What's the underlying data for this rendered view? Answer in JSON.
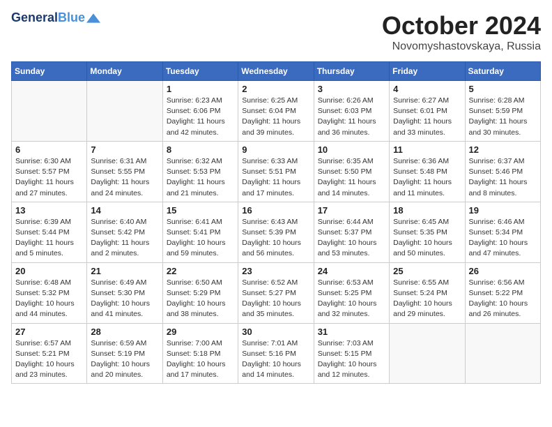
{
  "header": {
    "logo_line1": "General",
    "logo_line2": "Blue",
    "month_year": "October 2024",
    "location": "Novomyshastovskaya, Russia"
  },
  "weekdays": [
    "Sunday",
    "Monday",
    "Tuesday",
    "Wednesday",
    "Thursday",
    "Friday",
    "Saturday"
  ],
  "weeks": [
    [
      {
        "day": "",
        "info": ""
      },
      {
        "day": "",
        "info": ""
      },
      {
        "day": "1",
        "info": "Sunrise: 6:23 AM\nSunset: 6:06 PM\nDaylight: 11 hours and 42 minutes."
      },
      {
        "day": "2",
        "info": "Sunrise: 6:25 AM\nSunset: 6:04 PM\nDaylight: 11 hours and 39 minutes."
      },
      {
        "day": "3",
        "info": "Sunrise: 6:26 AM\nSunset: 6:03 PM\nDaylight: 11 hours and 36 minutes."
      },
      {
        "day": "4",
        "info": "Sunrise: 6:27 AM\nSunset: 6:01 PM\nDaylight: 11 hours and 33 minutes."
      },
      {
        "day": "5",
        "info": "Sunrise: 6:28 AM\nSunset: 5:59 PM\nDaylight: 11 hours and 30 minutes."
      }
    ],
    [
      {
        "day": "6",
        "info": "Sunrise: 6:30 AM\nSunset: 5:57 PM\nDaylight: 11 hours and 27 minutes."
      },
      {
        "day": "7",
        "info": "Sunrise: 6:31 AM\nSunset: 5:55 PM\nDaylight: 11 hours and 24 minutes."
      },
      {
        "day": "8",
        "info": "Sunrise: 6:32 AM\nSunset: 5:53 PM\nDaylight: 11 hours and 21 minutes."
      },
      {
        "day": "9",
        "info": "Sunrise: 6:33 AM\nSunset: 5:51 PM\nDaylight: 11 hours and 17 minutes."
      },
      {
        "day": "10",
        "info": "Sunrise: 6:35 AM\nSunset: 5:50 PM\nDaylight: 11 hours and 14 minutes."
      },
      {
        "day": "11",
        "info": "Sunrise: 6:36 AM\nSunset: 5:48 PM\nDaylight: 11 hours and 11 minutes."
      },
      {
        "day": "12",
        "info": "Sunrise: 6:37 AM\nSunset: 5:46 PM\nDaylight: 11 hours and 8 minutes."
      }
    ],
    [
      {
        "day": "13",
        "info": "Sunrise: 6:39 AM\nSunset: 5:44 PM\nDaylight: 11 hours and 5 minutes."
      },
      {
        "day": "14",
        "info": "Sunrise: 6:40 AM\nSunset: 5:42 PM\nDaylight: 11 hours and 2 minutes."
      },
      {
        "day": "15",
        "info": "Sunrise: 6:41 AM\nSunset: 5:41 PM\nDaylight: 10 hours and 59 minutes."
      },
      {
        "day": "16",
        "info": "Sunrise: 6:43 AM\nSunset: 5:39 PM\nDaylight: 10 hours and 56 minutes."
      },
      {
        "day": "17",
        "info": "Sunrise: 6:44 AM\nSunset: 5:37 PM\nDaylight: 10 hours and 53 minutes."
      },
      {
        "day": "18",
        "info": "Sunrise: 6:45 AM\nSunset: 5:35 PM\nDaylight: 10 hours and 50 minutes."
      },
      {
        "day": "19",
        "info": "Sunrise: 6:46 AM\nSunset: 5:34 PM\nDaylight: 10 hours and 47 minutes."
      }
    ],
    [
      {
        "day": "20",
        "info": "Sunrise: 6:48 AM\nSunset: 5:32 PM\nDaylight: 10 hours and 44 minutes."
      },
      {
        "day": "21",
        "info": "Sunrise: 6:49 AM\nSunset: 5:30 PM\nDaylight: 10 hours and 41 minutes."
      },
      {
        "day": "22",
        "info": "Sunrise: 6:50 AM\nSunset: 5:29 PM\nDaylight: 10 hours and 38 minutes."
      },
      {
        "day": "23",
        "info": "Sunrise: 6:52 AM\nSunset: 5:27 PM\nDaylight: 10 hours and 35 minutes."
      },
      {
        "day": "24",
        "info": "Sunrise: 6:53 AM\nSunset: 5:25 PM\nDaylight: 10 hours and 32 minutes."
      },
      {
        "day": "25",
        "info": "Sunrise: 6:55 AM\nSunset: 5:24 PM\nDaylight: 10 hours and 29 minutes."
      },
      {
        "day": "26",
        "info": "Sunrise: 6:56 AM\nSunset: 5:22 PM\nDaylight: 10 hours and 26 minutes."
      }
    ],
    [
      {
        "day": "27",
        "info": "Sunrise: 6:57 AM\nSunset: 5:21 PM\nDaylight: 10 hours and 23 minutes."
      },
      {
        "day": "28",
        "info": "Sunrise: 6:59 AM\nSunset: 5:19 PM\nDaylight: 10 hours and 20 minutes."
      },
      {
        "day": "29",
        "info": "Sunrise: 7:00 AM\nSunset: 5:18 PM\nDaylight: 10 hours and 17 minutes."
      },
      {
        "day": "30",
        "info": "Sunrise: 7:01 AM\nSunset: 5:16 PM\nDaylight: 10 hours and 14 minutes."
      },
      {
        "day": "31",
        "info": "Sunrise: 7:03 AM\nSunset: 5:15 PM\nDaylight: 10 hours and 12 minutes."
      },
      {
        "day": "",
        "info": ""
      },
      {
        "day": "",
        "info": ""
      }
    ]
  ]
}
